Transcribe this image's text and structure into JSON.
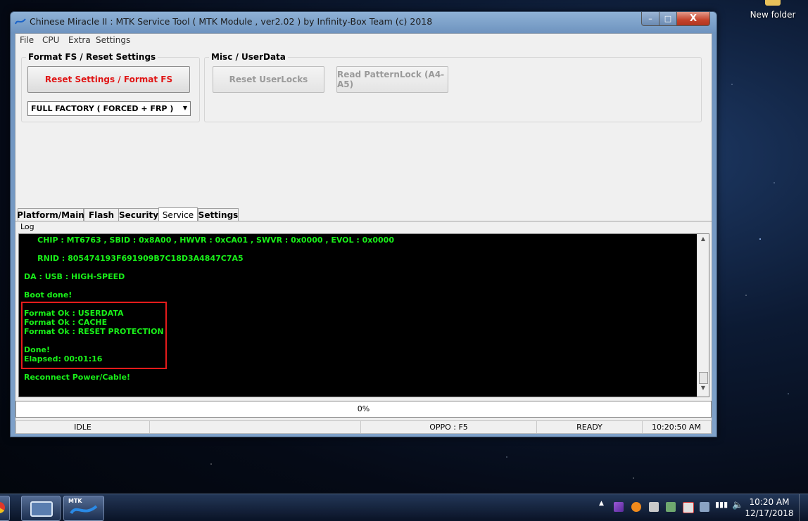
{
  "desktop": {
    "icon_label": "New folder"
  },
  "window": {
    "title": "Chinese Miracle II : MTK Service Tool ( MTK Module , ver2.02  ) by Infinity-Box Team (c) 2018",
    "controls": {
      "minimize": "–",
      "maximize": "□",
      "close": "X"
    }
  },
  "menu": [
    "File",
    "CPU",
    "Extra",
    "Settings"
  ],
  "format_group": {
    "title": "Format FS / Reset Settings",
    "button": "Reset Settings / Format FS",
    "select_value": "FULL FACTORY ( FORCED + FRP )"
  },
  "misc_group": {
    "title": "Misc  /  UserData",
    "reset_userlocks": "Reset UserLocks",
    "read_patternlock": "Read PatternLock (A4-A5)"
  },
  "tabs": [
    {
      "label": "Platform/Main",
      "active": false
    },
    {
      "label": "Flash",
      "active": false
    },
    {
      "label": "Security",
      "active": false
    },
    {
      "label": "Service",
      "active": true
    },
    {
      "label": "Settings",
      "active": false
    }
  ],
  "log": {
    "label": "Log",
    "lines": [
      "     CHIP : MT6763 , SBID : 0x8A00 , HWVR : 0xCA01 , SWVR : 0x0000 , EVOL : 0x0000",
      "",
      "     RNID : 805474193F691909B7C18D3A4847C7A5",
      "",
      "DA : USB : HIGH-SPEED",
      "",
      "Boot done!",
      "",
      "Format Ok : USERDATA",
      "Format Ok : CACHE",
      "Format Ok : RESET PROTECTION",
      "",
      "Done!",
      "Elapsed: 00:01:16",
      "",
      "Reconnect Power/Cable!"
    ],
    "text_color": "#19f019"
  },
  "progress": {
    "value": 0,
    "label": "0%"
  },
  "status": {
    "state": "IDLE",
    "empty": "",
    "device": "OPPO : F5",
    "ready": "READY",
    "time": "10:20:50 AM"
  },
  "taskbar": {
    "clock_time": "10:20 AM",
    "clock_date": "12/17/2018",
    "mtk_label": "MTK"
  },
  "colors": {
    "accent_red": "#e01616",
    "highlight": "#e41b1b"
  }
}
